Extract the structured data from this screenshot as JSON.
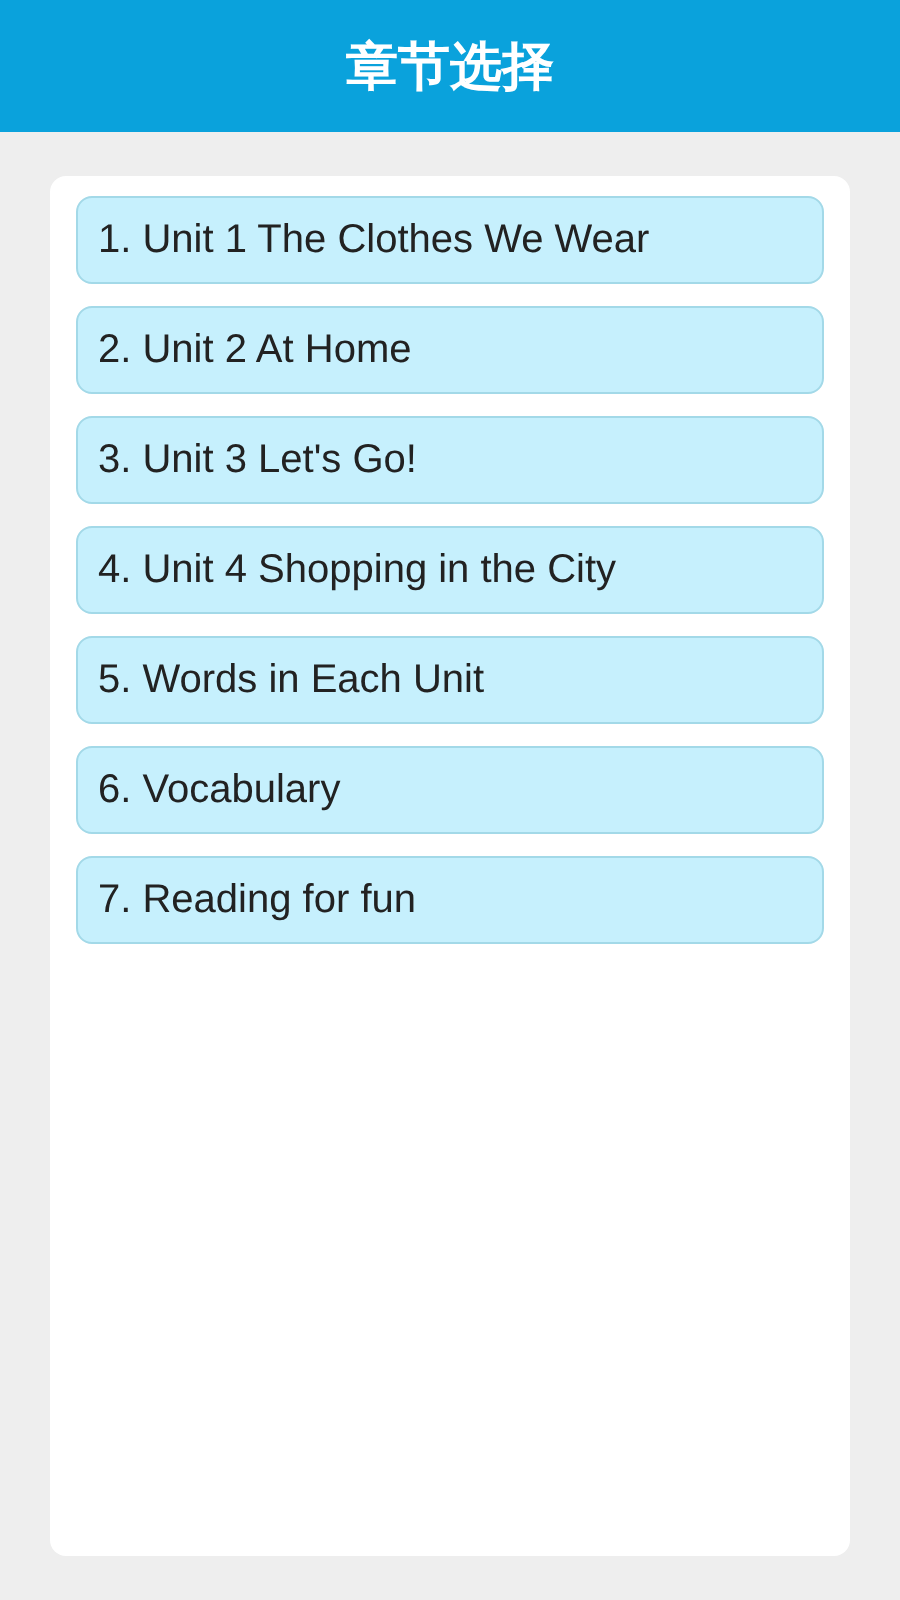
{
  "header": {
    "title": "章节选择"
  },
  "chapters": [
    {
      "label": "1. Unit 1 The Clothes We Wear"
    },
    {
      "label": "2. Unit 2 At Home"
    },
    {
      "label": "3. Unit 3 Let's Go!"
    },
    {
      "label": "4. Unit 4 Shopping in the City"
    },
    {
      "label": "5. Words in Each Unit"
    },
    {
      "label": "6. Vocabulary"
    },
    {
      "label": "7. Reading for fun"
    }
  ]
}
